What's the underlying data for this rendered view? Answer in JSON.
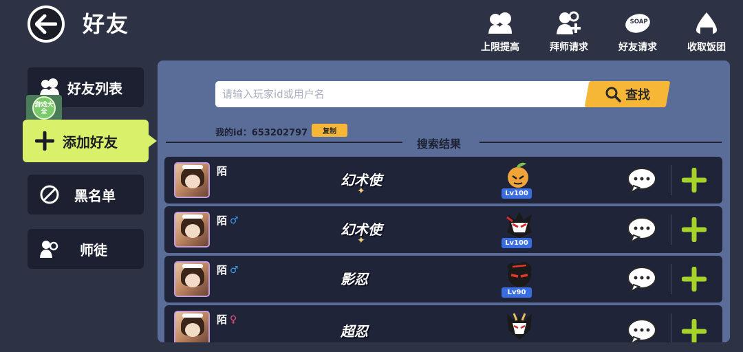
{
  "header": {
    "title": "好友",
    "actions": [
      {
        "label": "上限提高",
        "icon": "crowd-icon"
      },
      {
        "label": "拜师请求",
        "icon": "user-plus-icon"
      },
      {
        "label": "好友请求",
        "icon": "soap-icon"
      },
      {
        "label": "收取饭团",
        "icon": "rice-ball-icon"
      }
    ]
  },
  "sidebar": {
    "items": [
      {
        "label": "好友列表",
        "icon": "friends-icon",
        "active": false
      },
      {
        "label": "添加好友",
        "icon": "plus-icon",
        "active": true
      },
      {
        "label": "黑名单",
        "icon": "ban-icon",
        "active": false
      },
      {
        "label": "师徒",
        "icon": "mentor-icon",
        "active": false
      }
    ],
    "watermark": "游戏大全"
  },
  "search": {
    "placeholder": "请输入玩家id或用户名",
    "value": "",
    "button_label": "查找",
    "my_id_label": "我的id：653202797",
    "copy_label": "复制",
    "results_title": "搜索结果"
  },
  "results": [
    {
      "name": "陌",
      "gender": "",
      "title": "幻术使",
      "level": "Lv100",
      "pet": "orange-pet-icon"
    },
    {
      "name": "陌",
      "gender": "♂",
      "title": "幻术使",
      "level": "Lv100",
      "pet": "ninja-pet-icon"
    },
    {
      "name": "陌",
      "gender": "♂",
      "title": "影忍",
      "level": "Lv90",
      "pet": "shadow-pet-icon"
    },
    {
      "name": "陌",
      "gender": "♀",
      "title": "超忍",
      "level": "",
      "pet": "fox-mask-pet-icon"
    }
  ],
  "colors": {
    "background": "#2d3344",
    "panel": "#5a6d99",
    "row": "#1f2438",
    "accent_active": "#d9f06a",
    "search_button": "#f6b737",
    "add_green": "#a6d32a",
    "male": "#3a9bf0",
    "female": "#f0508a",
    "level_badge": "#3a6de0"
  }
}
